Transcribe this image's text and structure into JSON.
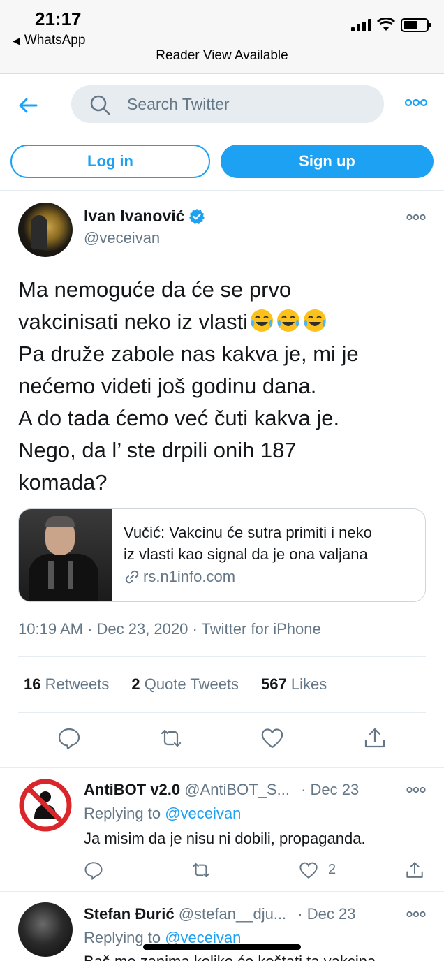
{
  "status_bar": {
    "time": "21:17",
    "back_app": "WhatsApp",
    "reader_view": "Reader View Available"
  },
  "header": {
    "search_placeholder": "Search Twitter",
    "login_label": "Log in",
    "signup_label": "Sign up",
    "accent_color": "#1da1f2"
  },
  "tweet": {
    "author_name": "Ivan Ivanović",
    "author_handle": "@veceivan",
    "verified": true,
    "text_lines": [
      "Ma nemoguće da će se prvo",
      "vakcinisati neko iz vlasti",
      "Pa druže zabole nas kakva je, mi je",
      "nećemo videti još godinu dana.",
      "A do tada ćemo već čuti kakva je.",
      "Nego, da l’ ste drpili onih 187",
      "komada?"
    ],
    "emoji": "face-with-tears-of-joy x3",
    "card": {
      "title_line1": "Vučić: Vakcinu će sutra primiti i neko",
      "title_line2": "iz vlasti kao signal da je ona valjana",
      "domain": "rs.n1info.com"
    },
    "meta": "10:19 AM · Dec 23, 2020 · Twitter for iPhone",
    "stats": {
      "retweets_count": "16",
      "retweets_label": "Retweets",
      "quotes_count": "2",
      "quotes_label": "Quote Tweets",
      "likes_count": "567",
      "likes_label": "Likes"
    }
  },
  "replies": [
    {
      "name": "AntiBOT v2.0",
      "handle": "@AntiBOT_S...",
      "date": "· Dec 23",
      "replying_prefix": "Replying to",
      "replying_to": "@veceivan",
      "text": "Ja misim da je nisu ni dobili, propaganda.",
      "like_count": "2"
    },
    {
      "name": "Stefan Đurić",
      "handle": "@stefan__dju...",
      "date": "· Dec 23",
      "replying_prefix": "Replying to",
      "replying_to": "@veceivan",
      "text": "Baš me zanima koliko će koštati ta vakcina"
    }
  ]
}
